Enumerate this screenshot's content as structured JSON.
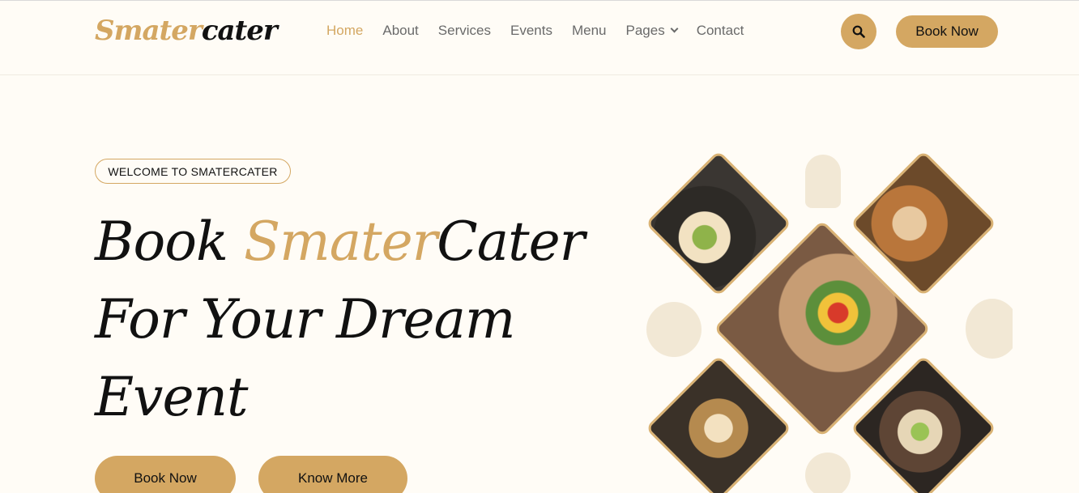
{
  "logo": {
    "part1": "Smater",
    "part2": "cater"
  },
  "nav": {
    "items": [
      "Home",
      "About",
      "Services",
      "Events",
      "Menu"
    ],
    "pages_label": "Pages",
    "contact_label": "Contact",
    "book_label": "Book Now"
  },
  "hero": {
    "badge": "WELCOME TO SMATERCATER",
    "headline_1": "Book ",
    "headline_gold": "Smater",
    "headline_2": "Cater",
    "headline_3": "For Your Dream",
    "headline_4": "Event",
    "book_label": "Book Now",
    "more_label": "Know More"
  },
  "colors": {
    "accent": "#d4a762",
    "background": "#fffcf6",
    "text": "#111111"
  }
}
